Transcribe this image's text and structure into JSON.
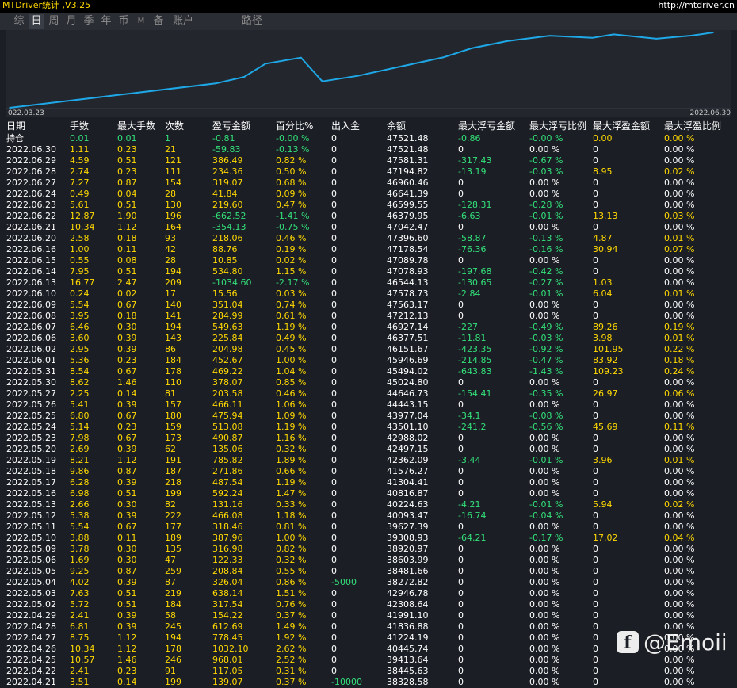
{
  "app": {
    "title": "MTDriver统计 ,V3.25",
    "url": "http://mtdriver.cn"
  },
  "tabs": [
    {
      "label": "综"
    },
    {
      "label": "日"
    },
    {
      "label": "周"
    },
    {
      "label": "月"
    },
    {
      "label": "季"
    },
    {
      "label": "年"
    },
    {
      "label": "币"
    },
    {
      "label": "M"
    },
    {
      "label": "备"
    },
    {
      "label": "账户"
    },
    {
      "label": "路径"
    }
  ],
  "active_tab": "日",
  "chart": {
    "x_start_label": "022.03.23",
    "x_end_label": "2022.06.30",
    "line_color": "#1ea8e8"
  },
  "chart_data": {
    "type": "line",
    "title": "",
    "xlabel": "",
    "ylabel": "",
    "x": [
      "2022.03.23",
      "2022.04.21",
      "2022.04.25",
      "2022.04.28",
      "2022.05.03",
      "2022.05.06",
      "2022.05.11",
      "2022.05.17",
      "2022.05.23",
      "2022.05.27",
      "2022.06.01",
      "2022.06.07",
      "2022.06.13",
      "2022.06.16",
      "2022.06.22",
      "2022.06.27",
      "2022.06.30"
    ],
    "series": [
      {
        "values": [
          33800,
          38235,
          39414,
          41837,
          42947,
          38604,
          39627,
          41304,
          42988,
          44647,
          45947,
          46927,
          46544,
          47179,
          46380,
          46961,
          47521
        ]
      }
    ]
  },
  "table": {
    "headers": [
      "日期",
      "手数",
      "最大手数",
      "次数",
      "盈亏金额",
      "百分比%",
      "出入金",
      "余额",
      "最大浮亏金额",
      "最大浮亏比例",
      "最大浮盈金额",
      "最大浮盈比例"
    ],
    "holding": [
      "持仓",
      "0.01",
      "0.01",
      "1",
      "-0.81",
      "-0.00 %",
      "0",
      "47521.48",
      "-0.86",
      "-0.00 %",
      "0.00",
      "0.00 %"
    ],
    "rows": [
      [
        "2022.06.30",
        "1.11",
        "0.23",
        "21",
        "-59.83",
        "-0.13 %",
        "0",
        "47521.48",
        "0",
        "0.00 %",
        "0",
        "0.00 %"
      ],
      [
        "2022.06.29",
        "4.59",
        "0.51",
        "121",
        "386.49",
        "0.82 %",
        "0",
        "47581.31",
        "-317.43",
        "-0.67 %",
        "0",
        "0.00 %"
      ],
      [
        "2022.06.28",
        "2.74",
        "0.23",
        "111",
        "234.36",
        "0.50 %",
        "0",
        "47194.82",
        "-13.19",
        "-0.03 %",
        "8.95",
        "0.02 %"
      ],
      [
        "2022.06.27",
        "7.27",
        "0.87",
        "154",
        "319.07",
        "0.68 %",
        "0",
        "46960.46",
        "0",
        "0.00 %",
        "0",
        "0.00 %"
      ],
      [
        "2022.06.24",
        "0.49",
        "0.04",
        "28",
        "41.84",
        "0.09 %",
        "0",
        "46641.39",
        "0",
        "0.00 %",
        "0",
        "0.00 %"
      ],
      [
        "2022.06.23",
        "5.61",
        "0.51",
        "130",
        "219.60",
        "0.47 %",
        "0",
        "46599.55",
        "-128.31",
        "-0.28 %",
        "0",
        "0.00 %"
      ],
      [
        "2022.06.22",
        "12.87",
        "1.90",
        "196",
        "-662.52",
        "-1.41 %",
        "0",
        "46379.95",
        "-6.63",
        "-0.01 %",
        "13.13",
        "0.03 %"
      ],
      [
        "2022.06.21",
        "10.34",
        "1.12",
        "164",
        "-354.13",
        "-0.75 %",
        "0",
        "47042.47",
        "0",
        "0.00 %",
        "0",
        "0.00 %"
      ],
      [
        "2022.06.20",
        "2.58",
        "0.18",
        "93",
        "218.06",
        "0.46 %",
        "0",
        "47396.60",
        "-58.87",
        "-0.13 %",
        "4.87",
        "0.01 %"
      ],
      [
        "2022.06.16",
        "1.00",
        "0.11",
        "42",
        "88.76",
        "0.19 %",
        "0",
        "47178.54",
        "-76.36",
        "-0.16 %",
        "30.94",
        "0.07 %"
      ],
      [
        "2022.06.15",
        "0.55",
        "0.08",
        "28",
        "10.85",
        "0.02 %",
        "0",
        "47089.78",
        "0",
        "0.00 %",
        "0",
        "0.00 %"
      ],
      [
        "2022.06.14",
        "7.95",
        "0.51",
        "194",
        "534.80",
        "1.15 %",
        "0",
        "47078.93",
        "-197.68",
        "-0.42 %",
        "0",
        "0.00 %"
      ],
      [
        "2022.06.13",
        "16.77",
        "2.47",
        "209",
        "-1034.60",
        "-2.17 %",
        "0",
        "46544.13",
        "-130.65",
        "-0.27 %",
        "1.03",
        "0.00 %"
      ],
      [
        "2022.06.10",
        "0.24",
        "0.02",
        "17",
        "15.56",
        "0.03 %",
        "0",
        "47578.73",
        "-2.84",
        "-0.01 %",
        "6.04",
        "0.01 %"
      ],
      [
        "2022.06.09",
        "5.54",
        "0.67",
        "140",
        "351.04",
        "0.74 %",
        "0",
        "47563.17",
        "0",
        "0.00 %",
        "0",
        "0.00 %"
      ],
      [
        "2022.06.08",
        "3.95",
        "0.18",
        "141",
        "284.99",
        "0.61 %",
        "0",
        "47212.13",
        "0",
        "0.00 %",
        "0",
        "0.00 %"
      ],
      [
        "2022.06.07",
        "6.46",
        "0.30",
        "194",
        "549.63",
        "1.19 %",
        "0",
        "46927.14",
        "-227",
        "-0.49 %",
        "89.26",
        "0.19 %"
      ],
      [
        "2022.06.06",
        "3.60",
        "0.39",
        "143",
        "225.84",
        "0.49 %",
        "0",
        "46377.51",
        "-11.81",
        "-0.03 %",
        "3.98",
        "0.01 %"
      ],
      [
        "2022.06.02",
        "2.95",
        "0.39",
        "86",
        "204.98",
        "0.45 %",
        "0",
        "46151.67",
        "-423.35",
        "-0.92 %",
        "101.95",
        "0.22 %"
      ],
      [
        "2022.06.01",
        "5.36",
        "0.23",
        "184",
        "452.67",
        "1.00 %",
        "0",
        "45946.69",
        "-214.85",
        "-0.47 %",
        "83.92",
        "0.18 %"
      ],
      [
        "2022.05.31",
        "8.54",
        "0.67",
        "178",
        "469.22",
        "1.04 %",
        "0",
        "45494.02",
        "-643.83",
        "-1.43 %",
        "109.23",
        "0.24 %"
      ],
      [
        "2022.05.30",
        "8.62",
        "1.46",
        "110",
        "378.07",
        "0.85 %",
        "0",
        "45024.80",
        "0",
        "0.00 %",
        "0",
        "0.00 %"
      ],
      [
        "2022.05.27",
        "2.25",
        "0.14",
        "81",
        "203.58",
        "0.46 %",
        "0",
        "44646.73",
        "-154.41",
        "-0.35 %",
        "26.97",
        "0.06 %"
      ],
      [
        "2022.05.26",
        "5.41",
        "0.39",
        "157",
        "466.11",
        "1.06 %",
        "0",
        "44443.15",
        "0",
        "0.00 %",
        "0",
        "0.00 %"
      ],
      [
        "2022.05.25",
        "6.80",
        "0.67",
        "180",
        "475.94",
        "1.09 %",
        "0",
        "43977.04",
        "-34.1",
        "-0.08 %",
        "0",
        "0.00 %"
      ],
      [
        "2022.05.24",
        "5.14",
        "0.23",
        "159",
        "513.08",
        "1.19 %",
        "0",
        "43501.10",
        "-241.2",
        "-0.56 %",
        "45.69",
        "0.11 %"
      ],
      [
        "2022.05.23",
        "7.98",
        "0.67",
        "173",
        "490.87",
        "1.16 %",
        "0",
        "42988.02",
        "0",
        "0.00 %",
        "0",
        "0.00 %"
      ],
      [
        "2022.05.20",
        "2.69",
        "0.39",
        "62",
        "135.06",
        "0.32 %",
        "0",
        "42497.15",
        "0",
        "0.00 %",
        "0",
        "0.00 %"
      ],
      [
        "2022.05.19",
        "8.21",
        "1.12",
        "191",
        "785.82",
        "1.89 %",
        "0",
        "42362.09",
        "-3.44",
        "-0.01 %",
        "3.96",
        "0.01 %"
      ],
      [
        "2022.05.18",
        "9.86",
        "0.87",
        "187",
        "271.86",
        "0.66 %",
        "0",
        "41576.27",
        "0",
        "0.00 %",
        "0",
        "0.00 %"
      ],
      [
        "2022.05.17",
        "6.28",
        "0.39",
        "218",
        "487.54",
        "1.19 %",
        "0",
        "41304.41",
        "0",
        "0.00 %",
        "0",
        "0.00 %"
      ],
      [
        "2022.05.16",
        "6.98",
        "0.51",
        "199",
        "592.24",
        "1.47 %",
        "0",
        "40816.87",
        "0",
        "0.00 %",
        "0",
        "0.00 %"
      ],
      [
        "2022.05.13",
        "2.66",
        "0.30",
        "82",
        "131.16",
        "0.33 %",
        "0",
        "40224.63",
        "-4.21",
        "-0.01 %",
        "5.94",
        "0.02 %"
      ],
      [
        "2022.05.12",
        "5.38",
        "0.39",
        "222",
        "466.08",
        "1.18 %",
        "0",
        "40093.47",
        "-16.74",
        "-0.04 %",
        "0",
        "0.00 %"
      ],
      [
        "2022.05.11",
        "5.54",
        "0.67",
        "177",
        "318.46",
        "0.81 %",
        "0",
        "39627.39",
        "0",
        "0.00 %",
        "0",
        "0.00 %"
      ],
      [
        "2022.05.10",
        "3.88",
        "0.11",
        "189",
        "387.96",
        "1.00 %",
        "0",
        "39308.93",
        "-64.21",
        "-0.17 %",
        "17.02",
        "0.04 %"
      ],
      [
        "2022.05.09",
        "3.78",
        "0.30",
        "135",
        "316.98",
        "0.82 %",
        "0",
        "38920.97",
        "0",
        "0.00 %",
        "0",
        "0.00 %"
      ],
      [
        "2022.05.06",
        "1.69",
        "0.30",
        "47",
        "122.33",
        "0.32 %",
        "0",
        "38603.99",
        "0",
        "0.00 %",
        "0",
        "0.00 %"
      ],
      [
        "2022.05.05",
        "9.25",
        "0.87",
        "259",
        "208.84",
        "0.55 %",
        "0",
        "38481.66",
        "0",
        "0.00 %",
        "0",
        "0.00 %"
      ],
      [
        "2022.05.04",
        "4.02",
        "0.39",
        "87",
        "326.04",
        "0.86 %",
        "-5000",
        "38272.82",
        "0",
        "0.00 %",
        "0",
        "0.00 %"
      ],
      [
        "2022.05.03",
        "7.63",
        "0.51",
        "219",
        "638.14",
        "1.51 %",
        "0",
        "42946.78",
        "0",
        "0.00 %",
        "0",
        "0.00 %"
      ],
      [
        "2022.05.02",
        "5.72",
        "0.51",
        "184",
        "317.54",
        "0.76 %",
        "0",
        "42308.64",
        "0",
        "0.00 %",
        "0",
        "0.00 %"
      ],
      [
        "2022.04.29",
        "2.41",
        "0.39",
        "58",
        "154.22",
        "0.37 %",
        "0",
        "41991.10",
        "0",
        "0.00 %",
        "0",
        "0.00 %"
      ],
      [
        "2022.04.28",
        "6.81",
        "0.39",
        "245",
        "612.69",
        "1.49 %",
        "0",
        "41836.88",
        "0",
        "0.00 %",
        "0",
        "0.00 %"
      ],
      [
        "2022.04.27",
        "8.75",
        "1.12",
        "194",
        "778.45",
        "1.92 %",
        "0",
        "41224.19",
        "0",
        "0.00 %",
        "0",
        "0.00 %"
      ],
      [
        "2022.04.26",
        "10.34",
        "1.12",
        "178",
        "1032.10",
        "2.62 %",
        "0",
        "40445.74",
        "0",
        "0.00 %",
        "0",
        "0.00 %"
      ],
      [
        "2022.04.25",
        "10.57",
        "1.46",
        "246",
        "968.01",
        "2.52 %",
        "0",
        "39413.64",
        "0",
        "0.00 %",
        "0",
        "0.00 %"
      ],
      [
        "2022.04.22",
        "2.41",
        "0.23",
        "91",
        "117.05",
        "0.31 %",
        "0",
        "38445.63",
        "0",
        "0.00 %",
        "0",
        "0.00 %"
      ],
      [
        "2022.04.21",
        "3.51",
        "0.14",
        "199",
        "139.07",
        "0.37 %",
        "-10000",
        "38328.58",
        "0",
        "0.00 %",
        "0",
        "0.00 %"
      ]
    ]
  },
  "watermark": {
    "logo": "f",
    "text": "@Emoii"
  }
}
